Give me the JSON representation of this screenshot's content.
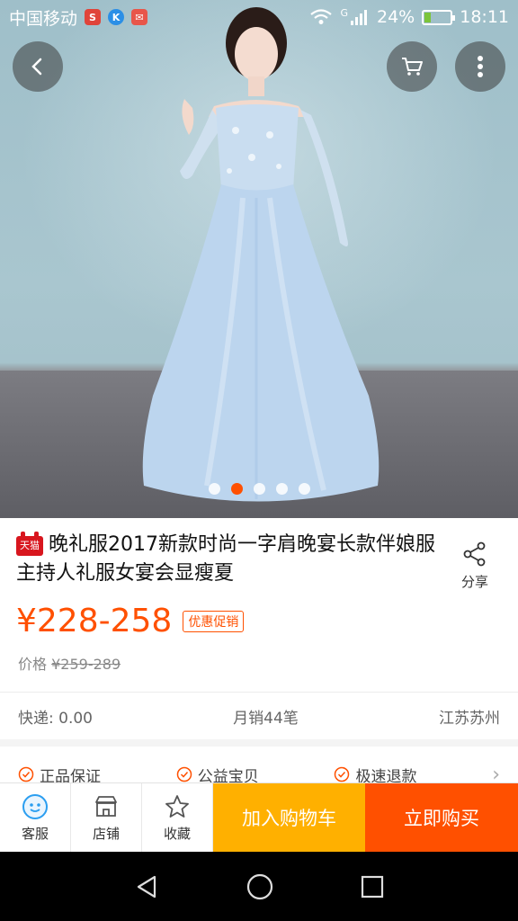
{
  "status_bar": {
    "carrier": "中国移动",
    "apps": [
      "S",
      "K",
      "✉"
    ],
    "signal_label": "G",
    "battery": "24%",
    "battery_level": 0.24,
    "time": "18:11"
  },
  "gallery": {
    "total_images": 5,
    "active_index": 1
  },
  "product": {
    "store_badge": "天猫",
    "title": "晚礼服2017新款时尚一字肩晚宴长款伴娘服主持人礼服女宴会显瘦夏",
    "share_label": "分享",
    "price": "¥228-258",
    "promo_tag": "优惠促销",
    "original_price_label": "价格",
    "original_price": "¥259-289",
    "shipping": "快递: 0.00",
    "monthly_sales": "月销44笔",
    "location": "江苏苏州"
  },
  "services": [
    {
      "label": "正品保证"
    },
    {
      "label": "公益宝贝"
    },
    {
      "label": "极速退款"
    }
  ],
  "action_bar": {
    "service_label": "客服",
    "shop_label": "店铺",
    "favorite_label": "收藏",
    "add_cart_label": "加入购物车",
    "buy_now_label": "立即购买"
  },
  "colors": {
    "accent": "#ff5000",
    "cart_button": "#ffb000",
    "icon_blue": "#2b9ef0"
  }
}
